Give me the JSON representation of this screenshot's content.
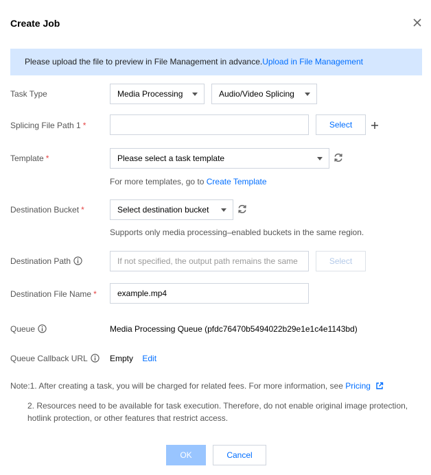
{
  "dialog": {
    "title": "Create Job"
  },
  "notice": {
    "text": "Please upload the file to preview in File Management in advance.",
    "link": "Upload in File Management"
  },
  "task_type": {
    "label": "Task Type",
    "primary_value": "Media Processing",
    "secondary_value": "Audio/Video Splicing"
  },
  "splicing_path": {
    "label": "Splicing File Path 1",
    "required_mark": "*",
    "value": "",
    "select_label": "Select"
  },
  "template": {
    "label": "Template",
    "required_mark": "*",
    "value": "Please select a task template",
    "hint_text": "For more templates, go to ",
    "hint_link": "Create Template"
  },
  "destination_bucket": {
    "label": "Destination Bucket",
    "required_mark": "*",
    "value": "Select destination bucket",
    "hint": "Supports only media processing–enabled buckets in the same region."
  },
  "destination_path": {
    "label": "Destination Path",
    "placeholder": "If not specified, the output path remains the same",
    "select_label": "Select"
  },
  "destination_file_name": {
    "label": "Destination File Name",
    "required_mark": "*",
    "value": "example.mp4"
  },
  "queue": {
    "label": "Queue",
    "value": "Media Processing Queue (pfdc76470b5494022b29e1e1c4e1143bd)"
  },
  "queue_callback": {
    "label": "Queue Callback URL",
    "value": "Empty",
    "edit_label": "Edit"
  },
  "notes": {
    "note1_text": "Note:1. After creating a task, you will be charged for related fees. For more information, see ",
    "note1_link": "Pricing",
    "note2": "2. Resources need to be available for task execution. Therefore, do not enable original image protection, hotlink protection, or other features that restrict access."
  },
  "footer": {
    "ok_label": "OK",
    "cancel_label": "Cancel"
  },
  "colors": {
    "accent": "#006eff",
    "notice_bg": "#d5e7ff",
    "required": "#e54545",
    "ok_disabled_bg": "#99c5ff"
  }
}
